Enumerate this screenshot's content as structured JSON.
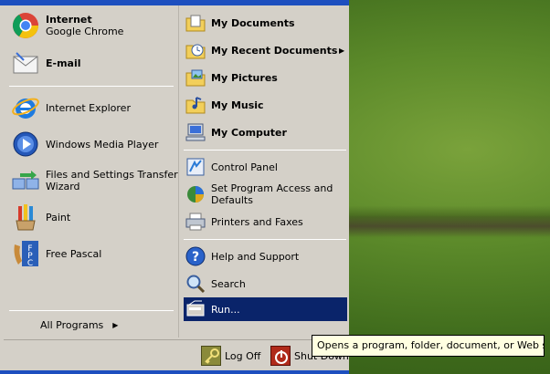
{
  "left_pane": {
    "pinned": [
      {
        "title": "Internet",
        "subtitle": "Google Chrome",
        "icon": "chrome-icon"
      },
      {
        "title": "E-mail",
        "icon": "email-icon"
      }
    ],
    "recent": [
      {
        "label": "Internet Explorer",
        "icon": "internet-explorer-icon"
      },
      {
        "label": "Windows Media Player",
        "icon": "media-player-icon"
      },
      {
        "label_line1": "Files and Settings Transfer",
        "label_line2": "Wizard",
        "icon": "transfer-wizard-icon"
      },
      {
        "label": "Paint",
        "icon": "paint-icon"
      },
      {
        "label": "Free Pascal",
        "icon": "free-pascal-icon"
      }
    ],
    "all_programs": {
      "label": "All Programs",
      "arrow": "▶"
    }
  },
  "right_pane": {
    "places": [
      {
        "label": "My Documents",
        "icon": "my-documents-icon"
      },
      {
        "label": "My Recent Documents",
        "icon": "my-recent-documents-icon",
        "arrow": "▶"
      },
      {
        "label": "My Pictures",
        "icon": "my-pictures-icon"
      },
      {
        "label": "My Music",
        "icon": "my-music-icon"
      },
      {
        "label": "My Computer",
        "icon": "my-computer-icon"
      }
    ],
    "settings": [
      {
        "label": "Control Panel",
        "icon": "control-panel-icon"
      },
      {
        "label_line1": "Set Program Access and",
        "label_line2": "Defaults",
        "icon": "program-access-icon"
      },
      {
        "label": "Printers and Faxes",
        "icon": "printers-icon"
      }
    ],
    "tools": [
      {
        "label": "Help and Support",
        "icon": "help-icon"
      },
      {
        "label": "Search",
        "icon": "search-icon"
      },
      {
        "label": "Run...",
        "icon": "run-icon"
      }
    ]
  },
  "bottom": {
    "log_off": "Log Off",
    "shut_down": "Shut Down"
  },
  "tooltip": "Opens a program, folder, document, or Web site.",
  "colors": {
    "menu_bg": "#d4d0c8",
    "highlight": "#0a246a",
    "title_blue": "#1d4fbf",
    "tooltip_bg": "#ffffe1"
  }
}
